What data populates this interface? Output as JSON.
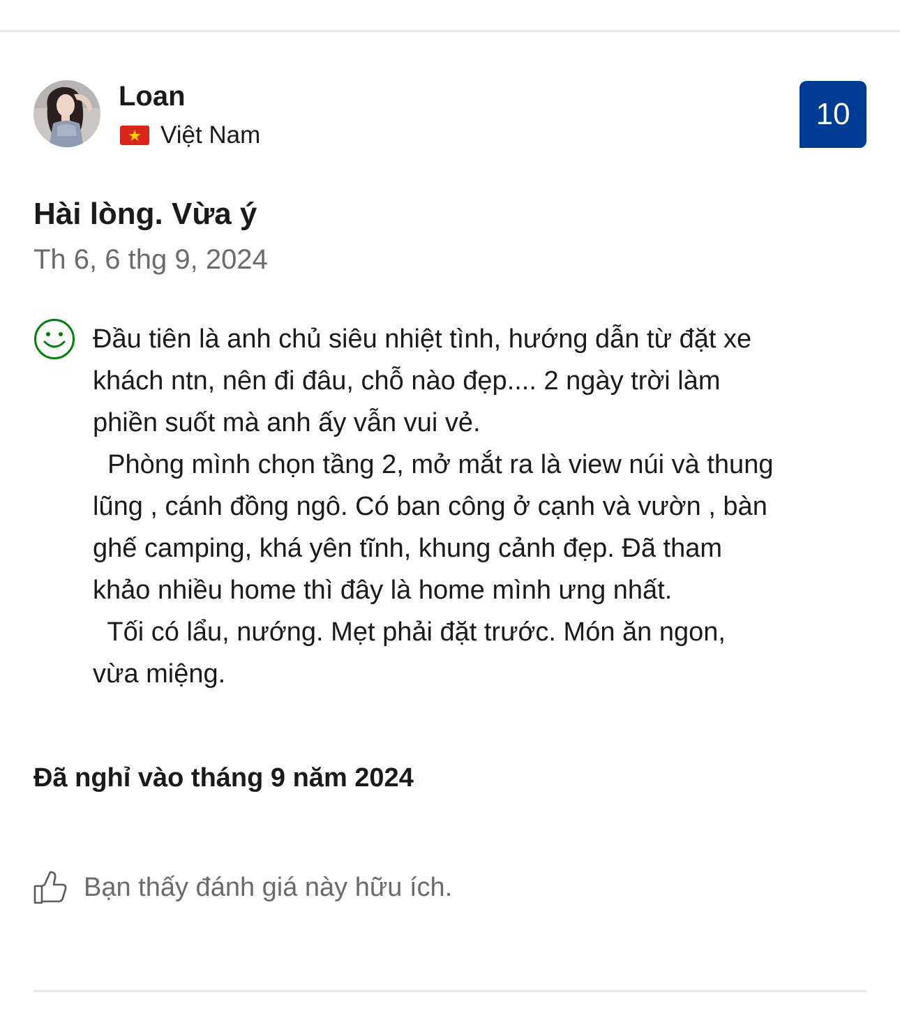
{
  "review": {
    "reviewer": {
      "name": "Loan",
      "country": "Việt Nam",
      "flag_icon": "vietnam-flag-icon"
    },
    "score": "10",
    "score_color": "#003b95",
    "title": "Hài lòng. Vừa ý",
    "date": "Th 6, 6 thg 9, 2024",
    "positive_icon": "smile-icon",
    "positive_icon_color": "#008009",
    "body_lines": [
      "Đầu tiên là anh chủ siêu nhiệt tình, hướng dẫn từ đặt xe",
      "khách ntn, nên đi đâu, chỗ nào đẹp.... 2 ngày trời làm",
      "phiền suốt mà anh ấy vẫn vui vẻ.",
      "  Phòng mình chọn tầng 2, mở mắt ra là view núi và thung",
      "lũng , cánh đồng ngô. Có ban công ở cạnh và vườn , bàn",
      "ghế camping, khá yên tĩnh, khung cảnh đẹp. Đã tham",
      "khảo nhiều home thì đây là home mình ưng nhất.",
      "  Tối có lẩu, nướng. Mẹt phải đặt trước. Món ăn ngon,",
      "vừa miệng."
    ],
    "stay_info": "Đã nghỉ vào tháng 9 năm 2024",
    "helpful": {
      "icon": "thumbs-up-icon",
      "label": "Bạn thấy đánh giá này hữu ích."
    }
  }
}
